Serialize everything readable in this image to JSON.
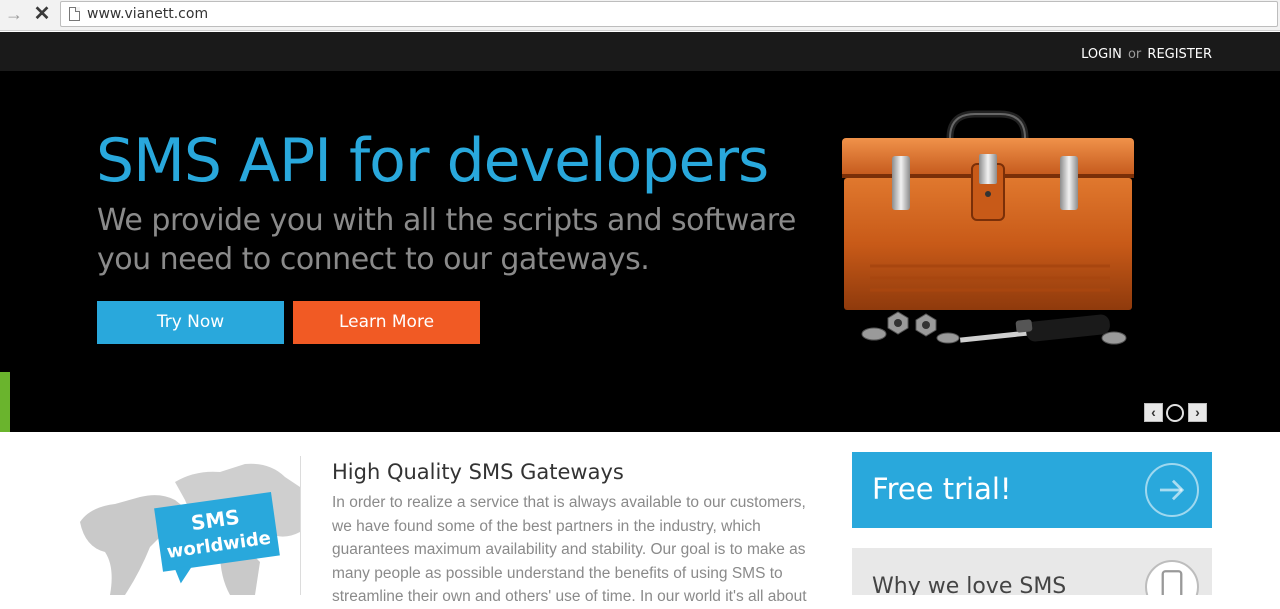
{
  "browser": {
    "url": "www.vianett.com",
    "back_icon": "back-arrow-icon",
    "stop_icon": "stop-icon"
  },
  "header": {
    "login": "LOGIN",
    "or": "or",
    "register": "REGISTER"
  },
  "hero": {
    "title": "SMS API for developers",
    "subtitle_line1": "We provide you with all the scripts and software",
    "subtitle_line2": "you need to connect to our gateways.",
    "try_label": "Try Now",
    "learn_label": "Learn More",
    "slider_prev": "‹",
    "slider_next": "›"
  },
  "content": {
    "map_badge_line1": "SMS",
    "map_badge_line2": "worldwide",
    "section_title": "High Quality SMS Gateways",
    "section_body": "In order to realize a service that is always available to our customers, we have found some of the best partners in the industry, which guarantees maximum availability and stability. Our goal is to make as many people as possible understand the benefits of using SMS to streamline their own and others' use of time. In our world it's all about",
    "free_trial": "Free trial!",
    "why_sms": "Why we love SMS"
  },
  "colors": {
    "brand_blue": "#29a8dc",
    "brand_orange": "#f15a24",
    "accent_green": "#6ab42d",
    "hero_bg": "#000000",
    "topbar_bg": "#1a1a1a"
  }
}
